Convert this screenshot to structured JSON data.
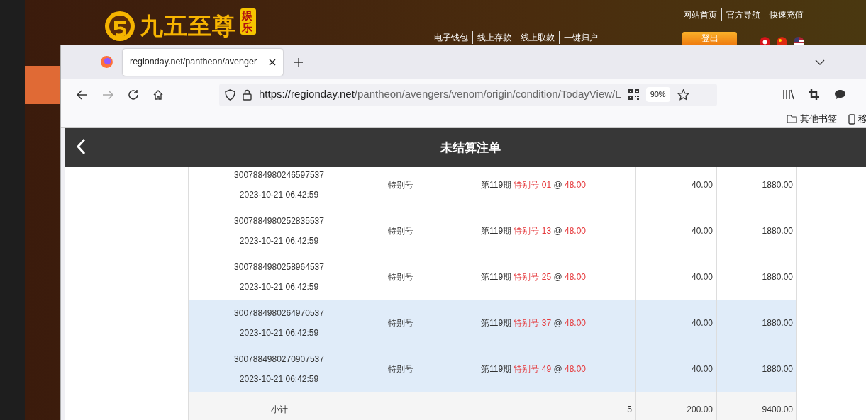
{
  "site": {
    "logo_text": "九五至尊",
    "logo_badge": "娱乐",
    "top_links": [
      "网站首页",
      "官方导航",
      "快速充值"
    ],
    "nav_links": [
      "电子钱包",
      "线上存款",
      "线上取款",
      "一键归户"
    ],
    "logout": "登出"
  },
  "browser": {
    "tab_title": "regionday.net/pantheon/avenger",
    "url_host": "https://regionday.net",
    "url_path": "/pantheon/avengers/venom/origin/condition/TodayView/L",
    "zoom": "90%",
    "bookmarks": [
      "其他书签",
      "移"
    ]
  },
  "page": {
    "title": "未结算注单"
  },
  "bets": [
    {
      "id": "3007884980246597537",
      "time": "2023-10-21 06:42:59",
      "play": "特别号",
      "issue": "第119期",
      "pick": "特别号 01",
      "at": "@",
      "odds": "48.00",
      "amount": "40.00",
      "payout": "1880.00",
      "highlighted": false
    },
    {
      "id": "3007884980252835537",
      "time": "2023-10-21 06:42:59",
      "play": "特别号",
      "issue": "第119期",
      "pick": "特别号 13",
      "at": "@",
      "odds": "48.00",
      "amount": "40.00",
      "payout": "1880.00",
      "highlighted": false
    },
    {
      "id": "3007884980258964537",
      "time": "2023-10-21 06:42:59",
      "play": "特别号",
      "issue": "第119期",
      "pick": "特别号 25",
      "at": "@",
      "odds": "48.00",
      "amount": "40.00",
      "payout": "1880.00",
      "highlighted": false
    },
    {
      "id": "3007884980264970537",
      "time": "2023-10-21 06:42:59",
      "play": "特别号",
      "issue": "第119期",
      "pick": "特别号 37",
      "at": "@",
      "odds": "48.00",
      "amount": "40.00",
      "payout": "1880.00",
      "highlighted": true
    },
    {
      "id": "3007884980270907537",
      "time": "2023-10-21 06:42:59",
      "play": "特别号",
      "issue": "第119期",
      "pick": "特别号 49",
      "at": "@",
      "odds": "48.00",
      "amount": "40.00",
      "payout": "1880.00",
      "highlighted": true
    }
  ],
  "summary": {
    "label": "小计",
    "count": "5",
    "amount": "200.00",
    "payout": "9400.00"
  }
}
